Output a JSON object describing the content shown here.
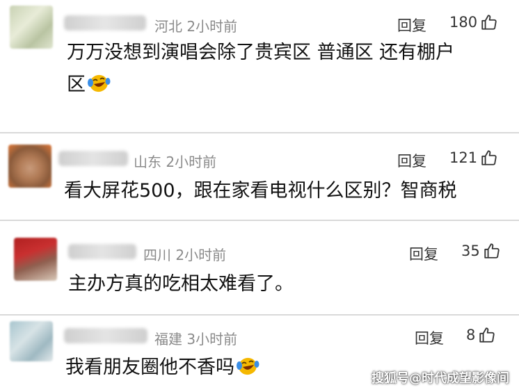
{
  "comments": [
    {
      "location_time": "河北 2小时前",
      "reply_label": "回复",
      "likes": "180",
      "text_line1": "万万没想到演唱会除了贵宾区 普通区 还有棚户",
      "text_line2": "区",
      "trailing_emoji": "laugh-cry-emoji"
    },
    {
      "location_time": "山东 2小时前",
      "reply_label": "回复",
      "likes": "121",
      "text_line1": "看大屏花500，跟在家看电视什么区别？智商税"
    },
    {
      "location_time": "四川 2小时前",
      "reply_label": "回复",
      "likes": "35",
      "text_line1": "主办方真的吃相太难看了。"
    },
    {
      "location_time": "福建 3小时前",
      "reply_label": "回复",
      "likes": "8",
      "text_line1": "我看朋友圈他不香吗",
      "trailing_emoji": "laugh-cry-emoji"
    }
  ],
  "watermark": "搜狐号@时代成望影像间",
  "colors": {
    "meta_gray": "#8a8a8a",
    "text": "#111111",
    "divider": "#d9d9d9",
    "emoji_yellow": "#f5b800",
    "tear_blue": "#3a8ee6"
  }
}
